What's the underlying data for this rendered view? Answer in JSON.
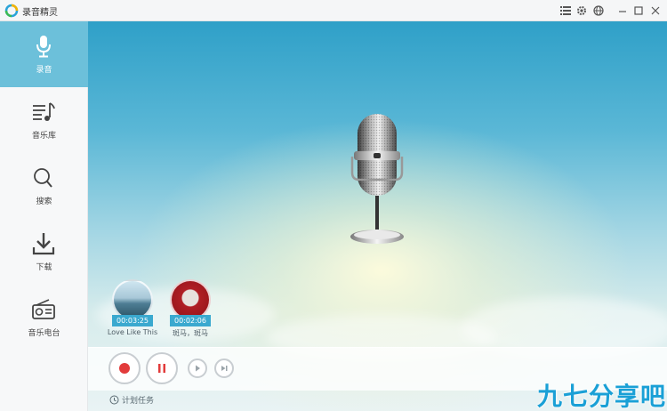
{
  "window": {
    "title": "录音精灵"
  },
  "sidebar": {
    "items": [
      {
        "label": "录音",
        "icon": "microphone-icon",
        "active": true
      },
      {
        "label": "音乐库",
        "icon": "music-list-icon",
        "active": false
      },
      {
        "label": "搜索",
        "icon": "search-icon",
        "active": false
      },
      {
        "label": "下载",
        "icon": "download-icon",
        "active": false
      },
      {
        "label": "音乐电台",
        "icon": "radio-icon",
        "active": false
      }
    ]
  },
  "recordings": [
    {
      "time": "00:03:25",
      "name": "Love Like This"
    },
    {
      "time": "00:02:06",
      "name": "斑马，斑马"
    }
  ],
  "footer": {
    "schedule_label": "计划任务"
  },
  "watermark": "九七分享吧",
  "colors": {
    "accent": "#6cc0da",
    "record_red": "#e23b3b",
    "watermark": "#1aa0d6"
  }
}
